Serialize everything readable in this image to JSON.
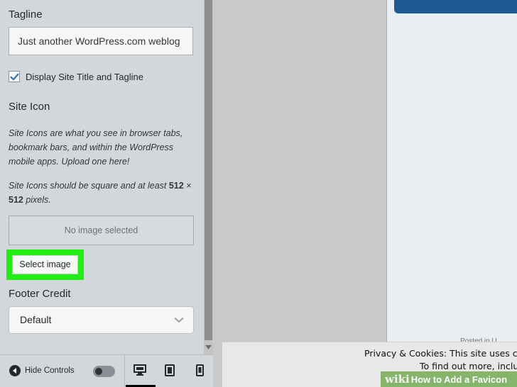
{
  "panel": {
    "tagline_heading": "Tagline",
    "tagline_value": "Just another WordPress.com weblog",
    "display_title_label": "Display Site Title and Tagline",
    "display_title_checked": true,
    "site_icon_heading": "Site Icon",
    "site_icon_desc_1": "Site Icons are what you see in browser tabs, bookmark bars, and within the WordPress mobile apps. Upload one here!",
    "site_icon_desc_2_prefix": "Site Icons should be square and at least ",
    "site_icon_desc_2_w": "512",
    "site_icon_desc_2_x": " × ",
    "site_icon_desc_2_h": "512",
    "site_icon_desc_2_suffix": " pixels.",
    "no_image_text": "No image selected",
    "select_image_label": "Select image",
    "highlight_color": "#22ee11",
    "footer_credit_heading": "Footer Credit",
    "footer_credit_value": "Default"
  },
  "footer": {
    "hide_controls_label": "Hide Controls",
    "devices": [
      "desktop-icon",
      "tablet-icon",
      "mobile-icon"
    ],
    "active_device": "desktop"
  },
  "preview": {
    "banner_color": "#1d5a94",
    "posted_note": "Posted in U",
    "cookie_line_1": "Privacy & Cookies: This site uses c",
    "cookie_line_2": "To find out more, inclu"
  },
  "watermark": {
    "wiki": "wiki",
    "how": "How to Add a Favicon"
  }
}
